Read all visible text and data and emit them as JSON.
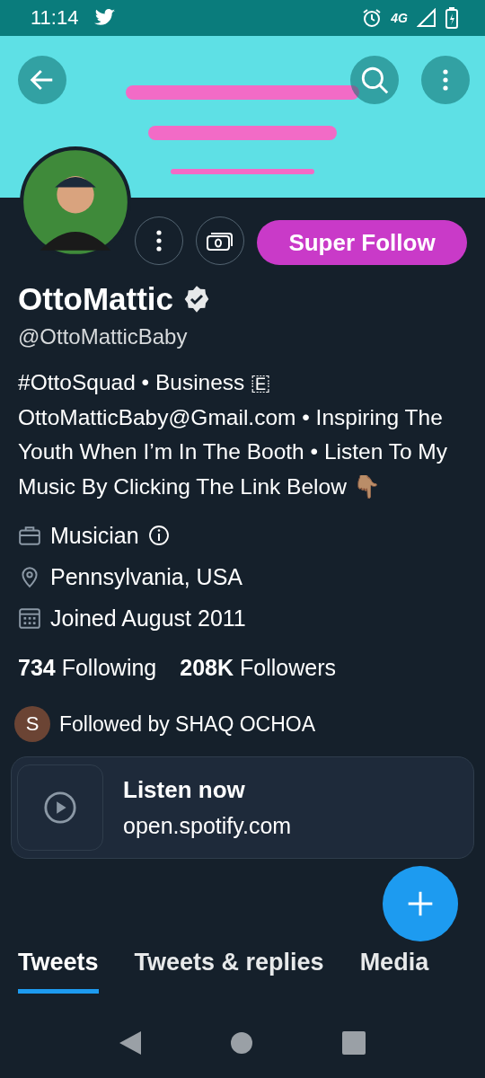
{
  "status_bar": {
    "time": "11:14",
    "network": "4G"
  },
  "profile": {
    "name": "OttoMattic",
    "verified": true,
    "handle": "@OttoMatticBaby",
    "super_follow_button": "Super Follow",
    "bio": "#OttoSquad • Business 🇪 OttoMatticBaby@Gmail.com • Inspiring The Youth When I’m In The Booth • Listen To My Music By Clicking The Link Below 👇🏽",
    "meta": [
      {
        "kind": "category",
        "text": "Musician",
        "info": true
      },
      {
        "kind": "location",
        "text": "Pennsylvania, USA",
        "info": false
      },
      {
        "kind": "joined",
        "text": "Joined August 2011",
        "info": false
      }
    ],
    "following_count": "734",
    "following_label": "Following",
    "followers_count": "208K",
    "followers_label": "Followers",
    "followed_by": {
      "initial": "S",
      "color": "#6b4434",
      "text": "Followed by SHAQ OCHOA"
    }
  },
  "link_card": {
    "title": "Listen now",
    "domain": "open.spotify.com"
  },
  "tabs": [
    {
      "label": "Tweets",
      "selected": true
    },
    {
      "label": "Tweets & replies",
      "selected": false
    },
    {
      "label": "Media",
      "selected": false
    }
  ]
}
